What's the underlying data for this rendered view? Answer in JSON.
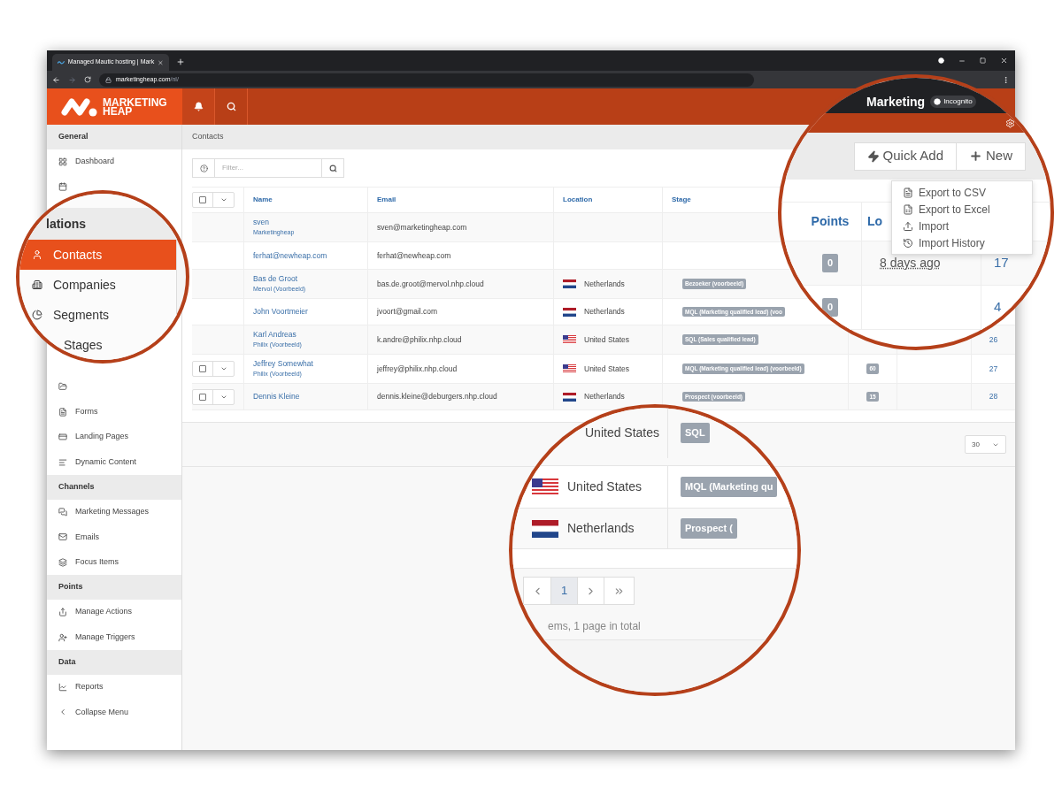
{
  "browser": {
    "tab_title": "Managed Mautic hosting | Mark",
    "url_host": "marketingheap.com",
    "url_path": "/nl/"
  },
  "app_header": {
    "logo_line_1": "MARKETING",
    "logo_line_2": "HEAP"
  },
  "sidebar": {
    "items": [
      {
        "kind": "header",
        "label": "General"
      },
      {
        "kind": "item",
        "label": "Dashboard"
      },
      {
        "kind": "icon_only"
      },
      {
        "kind": "icon_only"
      },
      {
        "kind": "item",
        "label": "Forms"
      },
      {
        "kind": "item",
        "label": "Landing Pages"
      },
      {
        "kind": "item",
        "label": "Dynamic Content"
      },
      {
        "kind": "header",
        "label": "Channels"
      },
      {
        "kind": "item",
        "label": "Marketing Messages"
      },
      {
        "kind": "item",
        "label": "Emails"
      },
      {
        "kind": "item",
        "label": "Focus Items"
      },
      {
        "kind": "header",
        "label": "Points"
      },
      {
        "kind": "item",
        "label": "Manage Actions"
      },
      {
        "kind": "item",
        "label": "Manage Triggers"
      },
      {
        "kind": "header",
        "label": "Data"
      },
      {
        "kind": "item",
        "label": "Reports"
      },
      {
        "kind": "item",
        "label": "Collapse Menu"
      }
    ]
  },
  "breadcrumb": "Contacts",
  "filter": {
    "placeholder": "Filter..."
  },
  "table": {
    "header_checked": false,
    "columns": [
      "Name",
      "Email",
      "Location",
      "Stage"
    ],
    "rows": [
      {
        "kind": "no_flag",
        "name": "sven",
        "company": "Marketingheap",
        "email": "sven@marketingheap.com"
      },
      {
        "kind": "no_flag",
        "name": "ferhat@newheap.com",
        "email": "ferhat@newheap.com"
      },
      {
        "kind": "nl_flag",
        "name": "Bas de Groot",
        "company": "Mervol (Voorbeeld)",
        "email": "bas.de.groot@mervol.nhp.cloud",
        "location": "Netherlands",
        "stage": "Bezoeker (voorbeeld)"
      },
      {
        "kind": "nl_flag",
        "name": "John Voortmeier",
        "email": "jvoort@gmail.com",
        "location": "Netherlands",
        "stage": "MQL (Marketing qualified lead) (voo"
      },
      {
        "kind": "us_flag",
        "name": "Karl Andreas",
        "company": "Philix (Voorbeeld)",
        "email": "k.andre@philix.nhp.cloud",
        "location": "United States",
        "stage": "SQL (Sales qualified lead)",
        "id": "26"
      },
      {
        "kind": "us_flag",
        "checked": false,
        "name": "Jeffrey Somewhat",
        "company": "Philix (Voorbeeld)",
        "email": "jeffrey@philix.nhp.cloud",
        "location": "United States",
        "stage": "MQL (Marketing qualified lead) (voorbeeld)",
        "points": "60",
        "id": "27"
      },
      {
        "kind": "nl_flag",
        "checked": false,
        "name": "Dennis Kleine",
        "email": "dennis.kleine@deburgers.nhp.cloud",
        "location": "Netherlands",
        "stage": "Prospect (voorbeeld)",
        "points": "15",
        "id": "28"
      }
    ]
  },
  "pagination": {
    "per_page": "30"
  },
  "magnifier_sidebar": {
    "section": "lations",
    "items": [
      {
        "label": "Contacts",
        "selected": true
      },
      {
        "label": "Companies",
        "selected": false
      },
      {
        "label": "Segments",
        "selected": false
      },
      {
        "label": "Stages",
        "selected": false
      }
    ]
  },
  "magnifier_actions": {
    "window_title": "Marketing",
    "incognito": "Incognito",
    "buttons": [
      "Quick Add",
      "New"
    ],
    "menu": [
      "Export to CSV",
      "Export to Excel",
      "Import",
      "Import History"
    ],
    "columns": [
      "Points",
      "Lo"
    ],
    "rows": [
      {
        "points": "0",
        "last_active": "8 days ago",
        "id": "17"
      },
      {
        "points": "0",
        "id": "4"
      }
    ]
  },
  "magnifier_table": {
    "rows": [
      {
        "kind": "no_flag",
        "location": "United States",
        "stage": "SQL"
      },
      {
        "kind": "us_flag",
        "location": "United States",
        "stage": "MQL (Marketing qu"
      },
      {
        "kind": "nl_flag",
        "location": "Netherlands",
        "stage": "Prospect ("
      }
    ],
    "pages": [
      {
        "label": "1",
        "selected": true
      }
    ],
    "summary": "ems, 1 page in total"
  }
}
